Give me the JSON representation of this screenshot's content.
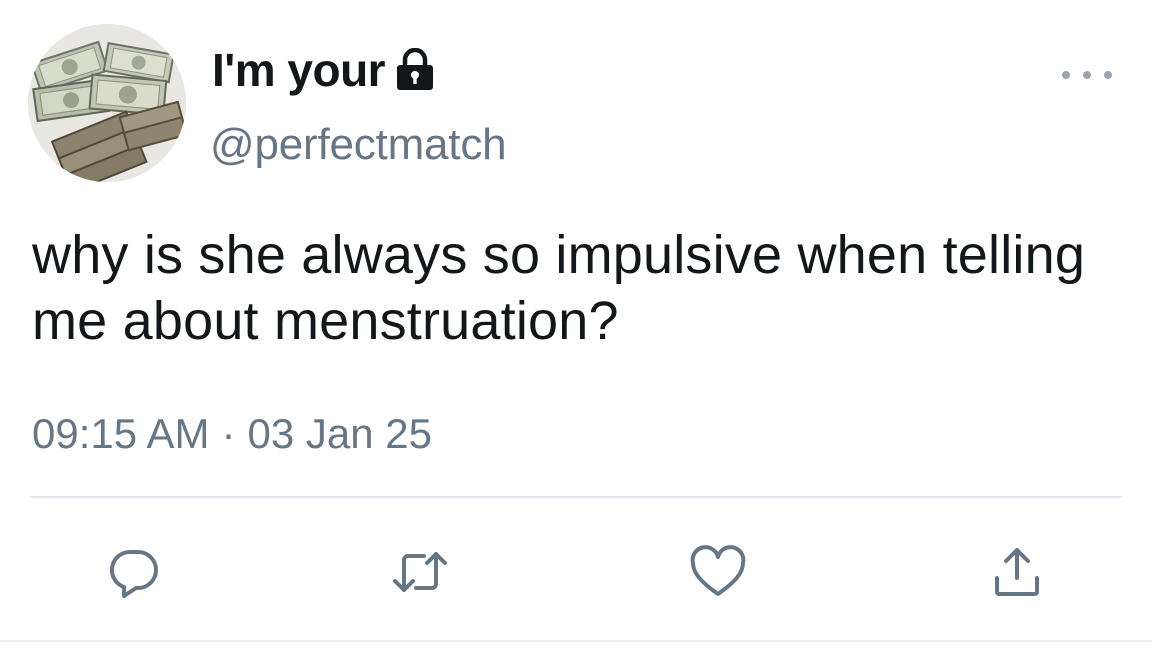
{
  "user": {
    "display_name": "I'm your",
    "handle": "@perfectmatch",
    "avatar_icon": "money-stacks-avatar",
    "name_icon": "lock-icon"
  },
  "tweet": {
    "text": "why is she always so impulsive when telling me about menstruation?",
    "time": "09:15 AM",
    "separator": "·",
    "date": "03 Jan 25"
  },
  "actions": [
    {
      "name": "reply",
      "icon": "reply-icon"
    },
    {
      "name": "retweet",
      "icon": "retweet-icon"
    },
    {
      "name": "like",
      "icon": "heart-icon"
    },
    {
      "name": "share",
      "icon": "share-icon"
    }
  ],
  "colors": {
    "text": "#14171a",
    "secondary": "#657786",
    "icon": "#657786",
    "divider": "#e1e8ed"
  }
}
